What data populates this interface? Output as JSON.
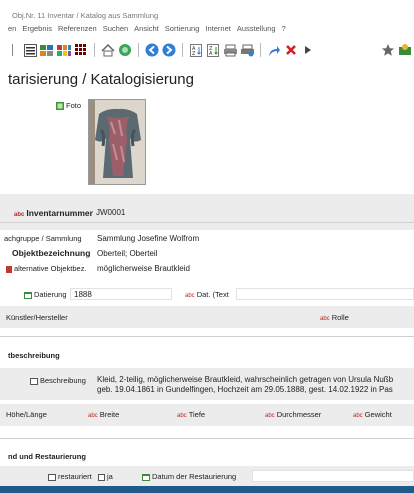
{
  "window": {
    "title": "Obj.Nr. 11  Inventar / Katalog aus Sammlung"
  },
  "menu": [
    "en",
    "Ergebnis",
    "Referenzen",
    "Suchen",
    "Ansicht",
    "Sortierung",
    "Internet",
    "Ausstellung",
    "?"
  ],
  "toolbar_icons": [
    "lines-icon",
    "list-icon",
    "tiles-color-icon",
    "grid-icon",
    "home-icon",
    "search-globe-icon",
    "back-arrow-icon",
    "forward-arrow-icon",
    "sort-az-icon",
    "sort-za-icon",
    "print-icon",
    "print-preview-icon",
    "share-arrow-icon",
    "close-x-icon",
    "play-icon",
    "star-icon",
    "extra-icon"
  ],
  "page": {
    "heading": "tarisierung / Katalogisierung"
  },
  "foto": {
    "label": "Foto"
  },
  "inventarnummer": {
    "label": "Inventarnummer",
    "value": "JW0001"
  },
  "sammlung": {
    "label": "achgruppe / Sammlung",
    "value": "Sammlung Josefine Wolfrom"
  },
  "objektbezeichnung": {
    "label": "Objektbezeichnung",
    "value": "Oberteil; Oberteil"
  },
  "alt_objektbez": {
    "label": "alternative Objektbez.",
    "value": "möglicherweise Brautkleid"
  },
  "datierung": {
    "label": "Datierung",
    "value": "1888",
    "dat_text_label": "Dat. (Text"
  },
  "kuenstler": {
    "label": "Künstler/Hersteller",
    "rolle_label": "Rolle"
  },
  "section_beschreibung": {
    "title": "tbeschreibung"
  },
  "beschreibung": {
    "label": "Beschreibung",
    "line1": "Kleid, 2-teilig, möglicherweise Brautkleid, wahrscheinlich getragen von Ursula Nußb",
    "line2": "geb. 19.04.1861 in Gundelfingen, Hochzeit am 29.05.1888, gest. 14.02.1922 in Pas"
  },
  "masse": {
    "hoehe": "Höhe/Länge",
    "breite": "Breite",
    "tiefe": "Tiefe",
    "durchmesser": "Durchmesser",
    "gewicht": "Gewicht"
  },
  "section_restaurierung": {
    "title": "nd und Restaurierung"
  },
  "restauriert": {
    "label": "restauriert",
    "value": "ja",
    "datum_label": "Datum der Restaurierung"
  },
  "colors": {
    "accent_blue": "#1f5a8b",
    "band_gray": "#ececec",
    "required_red": "#cc2222"
  }
}
